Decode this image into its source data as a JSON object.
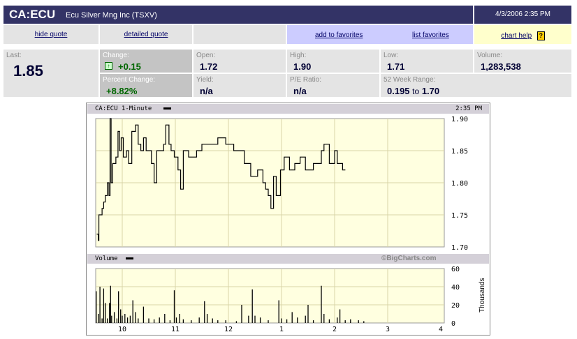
{
  "header": {
    "symbol": "CA:ECU",
    "company": "Ecu Silver Mng Inc (TSXV)",
    "datetime": "4/3/2006 2:35 PM"
  },
  "links": {
    "hide_quote": "hide quote",
    "detailed_quote": "detailed quote",
    "add_favorites": "add to favorites",
    "list_favorites": "list favorites",
    "chart_help": "chart help",
    "help_icon": "?"
  },
  "quote": {
    "last_label": "Last:",
    "last": "1.85",
    "change_label": "Change:",
    "change": "+0.15",
    "pct_label": "Percent Change:",
    "pct": "+8.82%",
    "open_label": "Open:",
    "open": "1.72",
    "high_label": "High:",
    "high": "1.90",
    "low_label": "Low:",
    "low": "1.71",
    "volume_label": "Volume:",
    "volume": "1,283,538",
    "yield_label": "Yield:",
    "yield": "n/a",
    "pe_label": "P/E Ratio:",
    "pe": "n/a",
    "range_label": "52 Week Range:",
    "range_low": "0.195",
    "range_to": "to",
    "range_high": "1.70"
  },
  "chart": {
    "title": "CA:ECU 1-Minute",
    "time": "2:35 PM",
    "volume_title": "Volume",
    "copyright": "©BigCharts.com",
    "volume_unit": "Thousands",
    "price_ticks": [
      "1.90",
      "1.85",
      "1.80",
      "1.75",
      "1.70"
    ],
    "volume_ticks": [
      "60",
      "40",
      "20",
      "0"
    ],
    "x_ticks": [
      "10",
      "11",
      "12",
      "1",
      "2",
      "3",
      "4"
    ]
  },
  "chart_data": {
    "type": "line",
    "price": {
      "ylim": [
        1.7,
        1.9
      ],
      "x_hours": [
        9.5,
        16
      ],
      "points": [
        [
          9.52,
          1.72
        ],
        [
          9.55,
          1.71
        ],
        [
          9.56,
          1.75
        ],
        [
          9.62,
          1.76
        ],
        [
          9.65,
          1.77
        ],
        [
          9.68,
          1.78
        ],
        [
          9.72,
          1.8
        ],
        [
          9.75,
          1.78
        ],
        [
          9.77,
          1.9
        ],
        [
          9.79,
          1.8
        ],
        [
          9.82,
          1.83
        ],
        [
          9.88,
          1.84
        ],
        [
          9.92,
          1.88
        ],
        [
          9.95,
          1.85
        ],
        [
          9.98,
          1.87
        ],
        [
          10.02,
          1.84
        ],
        [
          10.08,
          1.85
        ],
        [
          10.12,
          1.83
        ],
        [
          10.18,
          1.88
        ],
        [
          10.25,
          1.89
        ],
        [
          10.3,
          1.86
        ],
        [
          10.35,
          1.85
        ],
        [
          10.4,
          1.87
        ],
        [
          10.45,
          1.85
        ],
        [
          10.55,
          1.83
        ],
        [
          10.6,
          1.8
        ],
        [
          10.65,
          1.85
        ],
        [
          10.78,
          1.86
        ],
        [
          10.82,
          1.89
        ],
        [
          10.88,
          1.86
        ],
        [
          10.92,
          1.85
        ],
        [
          10.98,
          1.84
        ],
        [
          11.05,
          1.82
        ],
        [
          11.1,
          1.79
        ],
        [
          11.15,
          1.85
        ],
        [
          11.25,
          1.84
        ],
        [
          11.4,
          1.85
        ],
        [
          11.5,
          1.86
        ],
        [
          11.7,
          1.86
        ],
        [
          11.8,
          1.87
        ],
        [
          11.95,
          1.86
        ],
        [
          12.1,
          1.85
        ],
        [
          12.3,
          1.83
        ],
        [
          12.42,
          1.81
        ],
        [
          12.55,
          1.82
        ],
        [
          12.65,
          1.8
        ],
        [
          12.7,
          1.79
        ],
        [
          12.75,
          1.78
        ],
        [
          12.8,
          1.76
        ],
        [
          12.85,
          1.81
        ],
        [
          12.9,
          1.78
        ],
        [
          12.98,
          1.82
        ],
        [
          13.05,
          1.84
        ],
        [
          13.15,
          1.82
        ],
        [
          13.25,
          1.83
        ],
        [
          13.35,
          1.84
        ],
        [
          13.45,
          1.82
        ],
        [
          13.6,
          1.83
        ],
        [
          13.75,
          1.85
        ],
        [
          13.8,
          1.86
        ],
        [
          13.9,
          1.83
        ],
        [
          14.0,
          1.85
        ],
        [
          14.05,
          1.83
        ],
        [
          14.15,
          1.82
        ]
      ]
    },
    "volume": {
      "ylim": [
        0,
        60
      ],
      "unit": "Thousands",
      "bars": [
        [
          9.51,
          35
        ],
        [
          9.55,
          10
        ],
        [
          9.58,
          40
        ],
        [
          9.62,
          5
        ],
        [
          9.65,
          38
        ],
        [
          9.68,
          22
        ],
        [
          9.72,
          5
        ],
        [
          9.76,
          22
        ],
        [
          9.78,
          41
        ],
        [
          9.8,
          8
        ],
        [
          9.85,
          12
        ],
        [
          9.9,
          5
        ],
        [
          9.93,
          35
        ],
        [
          9.97,
          15
        ],
        [
          10.0,
          8
        ],
        [
          10.05,
          10
        ],
        [
          10.1,
          6
        ],
        [
          10.15,
          8
        ],
        [
          10.2,
          25
        ],
        [
          10.25,
          12
        ],
        [
          10.3,
          5
        ],
        [
          10.4,
          18
        ],
        [
          10.5,
          5
        ],
        [
          10.6,
          4
        ],
        [
          10.7,
          6
        ],
        [
          10.8,
          10
        ],
        [
          10.9,
          3
        ],
        [
          10.98,
          36
        ],
        [
          11.02,
          6
        ],
        [
          11.08,
          10
        ],
        [
          11.15,
          4
        ],
        [
          11.3,
          3
        ],
        [
          11.45,
          6
        ],
        [
          11.55,
          24
        ],
        [
          11.6,
          10
        ],
        [
          11.7,
          5
        ],
        [
          11.8,
          3
        ],
        [
          11.95,
          3
        ],
        [
          12.15,
          2
        ],
        [
          12.25,
          20
        ],
        [
          12.38,
          8
        ],
        [
          12.45,
          37
        ],
        [
          12.5,
          8
        ],
        [
          12.6,
          6
        ],
        [
          12.75,
          3
        ],
        [
          12.95,
          25
        ],
        [
          13.0,
          5
        ],
        [
          13.1,
          4
        ],
        [
          13.2,
          12
        ],
        [
          13.3,
          6
        ],
        [
          13.45,
          8
        ],
        [
          13.5,
          20
        ],
        [
          13.6,
          3
        ],
        [
          13.75,
          41
        ],
        [
          13.8,
          10
        ],
        [
          13.9,
          4
        ],
        [
          14.05,
          6
        ],
        [
          14.1,
          15
        ],
        [
          14.2,
          3
        ],
        [
          14.3,
          4
        ],
        [
          14.45,
          3
        ],
        [
          14.55,
          2
        ]
      ]
    }
  }
}
